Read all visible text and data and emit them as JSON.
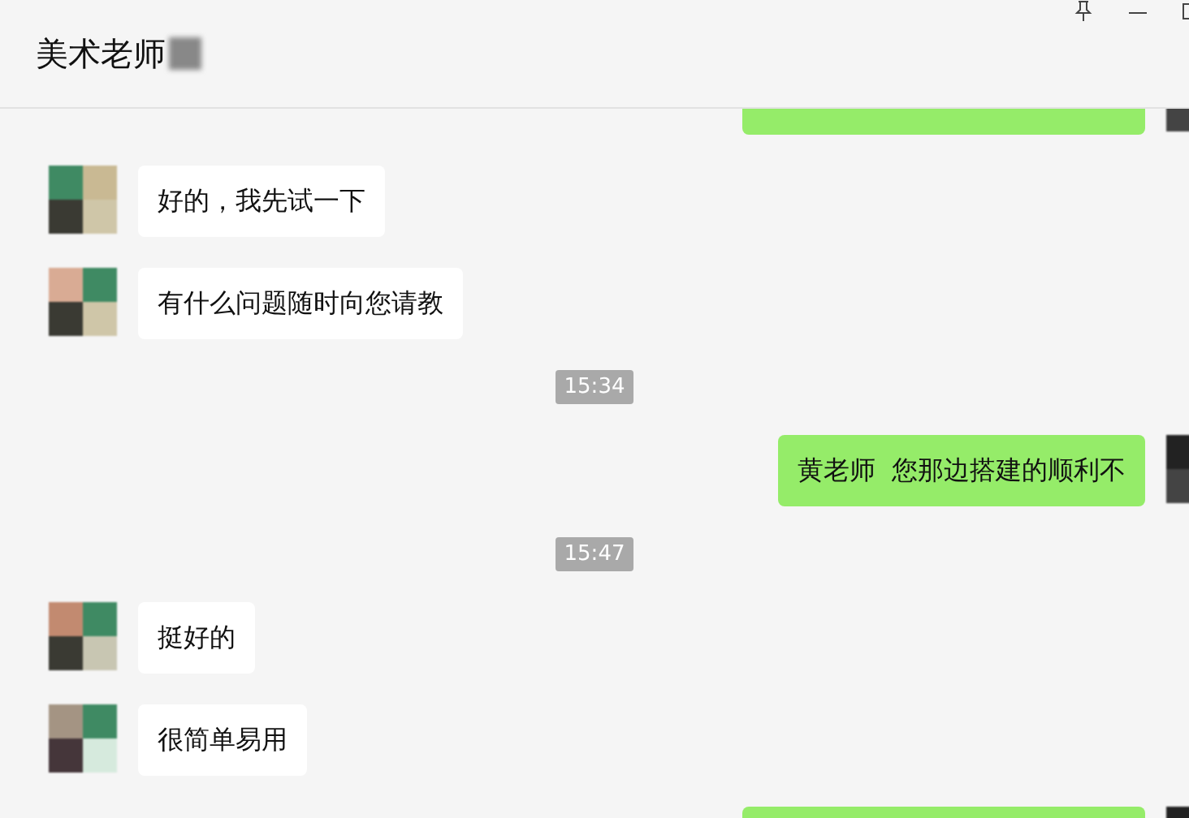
{
  "window": {
    "title": "美术老师"
  },
  "messages": [
    {
      "kind": "sent"
    },
    {
      "kind": "received",
      "text": "好的，我先试一下"
    },
    {
      "kind": "received",
      "text": "有什么问题随时向您请教"
    },
    {
      "kind": "time",
      "text": "15:34"
    },
    {
      "kind": "sent",
      "text": "黄老师  您那边搭建的顺利不"
    },
    {
      "kind": "time",
      "text": "15:47"
    },
    {
      "kind": "received",
      "text": "挺好的"
    },
    {
      "kind": "received",
      "text": "很简单易用"
    },
    {
      "kind": "sent"
    }
  ]
}
